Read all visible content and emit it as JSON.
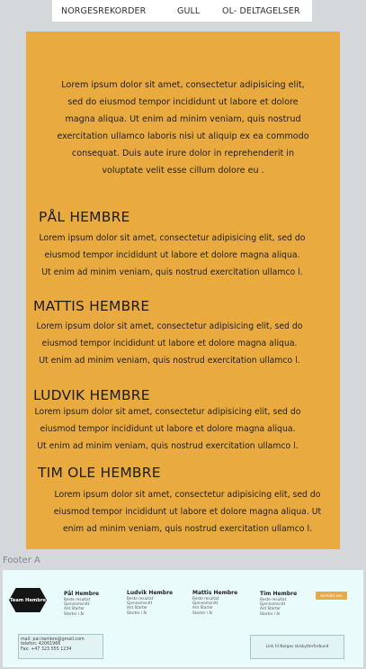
{
  "nav": {
    "items": [
      "NORGESREKORDER",
      "GULL",
      "OL- DELTAGELSER"
    ]
  },
  "intro": {
    "lines": [
      "Lorem ipsum dolor sit amet, consectetur adipisicing elit,",
      "sed do eiusmod tempor incididunt ut labore et dolore",
      "magna aliqua. Ut enim ad minim veniam, quis nostrud",
      "exercitation ullamco laboris nisi ut aliquip ex ea commodo",
      "consequat. Duis aute irure dolor in reprehenderit in",
      "voluptate velit esse cillum dolore eu ."
    ]
  },
  "athletes": [
    {
      "name": "PÅL HEMBRE",
      "lines": [
        "Lorem ipsum dolor sit amet, consectetur adipisicing elit, sed do",
        "eiusmod tempor incididunt ut labore et dolore magna aliqua.",
        "Ut enim ad minim veniam, quis nostrud exercitation ullamco l."
      ]
    },
    {
      "name": "MATTIS HEMBRE",
      "lines": [
        "Lorem ipsum dolor sit amet, consectetur adipisicing elit, sed do",
        "eiusmod tempor incididunt ut labore et dolore magna aliqua.",
        "Ut enim ad minim veniam, quis nostrud exercitation ullamco l."
      ]
    },
    {
      "name": "LUDVIK HEMBRE",
      "lines": [
        "Lorem ipsum dolor sit amet, consectetur adipisicing elit, sed do",
        "eiusmod tempor incididunt ut labore et dolore magna aliqua.",
        "Ut enim ad minim veniam, quis nostrud exercitation ullamco l."
      ]
    },
    {
      "name": "TIM OLE HEMBRE",
      "lines": [
        "Lorem ipsum dolor sit amet, consectetur adipisicing elit, sed do",
        "eiusmod tempor incididunt ut labore et dolore magna aliqua. Ut",
        "enim ad minim veniam, quis nostrud exercitation ullamco l."
      ]
    }
  ],
  "footer": {
    "label": "Footer A",
    "logo_text": "Team Hembre",
    "columns": [
      {
        "name": "Pål Hembre",
        "lines": [
          "Beste resultat",
          "Gjennomsnitt",
          "Ant Starter",
          "Starter i år"
        ]
      },
      {
        "name": "Ludvik Hembre",
        "lines": [
          "Beste resultat",
          "Gjennomsnitt",
          "Ant Starter",
          "Starter i år"
        ]
      },
      {
        "name": "Mattis Hembre",
        "lines": [
          "Beste resultat",
          "Gjennomsnitt",
          "Ant Starter",
          "Starter i år"
        ]
      },
      {
        "name": "Tim Hembre",
        "lines": [
          "Beste resultat",
          "Gjennomsnitt",
          "Ant Starter",
          "Starter i år"
        ]
      }
    ],
    "contact_label": "kontakt oss",
    "info_lines": [
      "mail: pal.hembre@gmail.com",
      "telefon: 42061966",
      "Fax: +47 323 555 1234"
    ],
    "link_text": "Link til Norges skiskytterforbund",
    "accent_color": "#e9aa40"
  }
}
